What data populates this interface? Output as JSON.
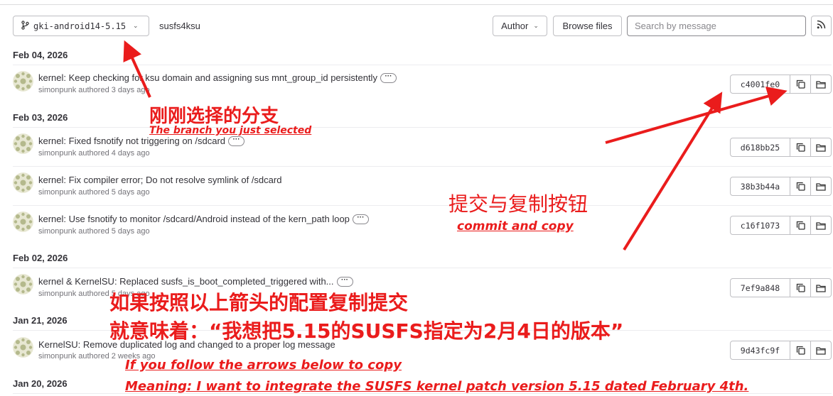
{
  "toolbar": {
    "branch": "gki-android14-5.15",
    "path": "susfs4ksu",
    "author_label": "Author",
    "browse_label": "Browse files",
    "search_placeholder": "Search by message"
  },
  "groups": [
    {
      "date": "Feb 04, 2026",
      "commits": [
        {
          "title": "kernel: Keep checking for ksu domain and assigning sus mnt_group_id persistently",
          "author": "simonpunk",
          "time": "authored 3 days ago",
          "sha": "c4001fe0",
          "has_more": true
        }
      ]
    },
    {
      "date": "Feb 03, 2026",
      "commits": [
        {
          "title": "kernel: Fixed fsnotify not triggering on /sdcard",
          "author": "simonpunk",
          "time": "authored 4 days ago",
          "sha": "d618bb25",
          "has_more": true
        },
        {
          "title": "kernel: Fix compiler error; Do not resolve symlink of /sdcard",
          "author": "simonpunk",
          "time": "authored 5 days ago",
          "sha": "38b3b44a",
          "has_more": false
        },
        {
          "title": "kernel: Use fsnotify to monitor /sdcard/Android instead of the kern_path loop",
          "author": "simonpunk",
          "time": "authored 5 days ago",
          "sha": "c16f1073",
          "has_more": true
        }
      ]
    },
    {
      "date": "Feb 02, 2026",
      "commits": [
        {
          "title": "kernel & KernelSU: Replaced susfs_is_boot_completed_triggered with...",
          "author": "simonpunk",
          "time": "authored 5 days ago",
          "sha": "7ef9a848",
          "has_more": true
        }
      ]
    },
    {
      "date": "Jan 21, 2026",
      "commits": [
        {
          "title": "KernelSU: Remove duplicated log and changed to a proper log message",
          "author": "simonpunk",
          "time": "authored 2 weeks ago",
          "sha": "9d43fc9f",
          "has_more": false
        }
      ]
    },
    {
      "date": "Jan 20, 2026",
      "commits": []
    }
  ],
  "annotations": {
    "branch_cn": "刚刚选择的分支",
    "branch_en": "The branch you just selected",
    "commit_cn": "提交与复制按钮",
    "commit_en": "commit and copy",
    "meaning_cn_1": "如果按照以上箭头的配置复制提交",
    "meaning_cn_2": "就意味着：“我想把5.15的SUSFS指定为2月4日的版本”",
    "meaning_en_1": "If you follow the arrows below to copy",
    "meaning_en_2": "Meaning: I want to integrate the SUSFS kernel patch version 5.15 dated February 4th."
  },
  "colors": {
    "annotation": "#ea1c1c",
    "avatar": "#b4b98c"
  },
  "icons": [
    "branch-icon",
    "chevron-down-icon",
    "rss-icon",
    "copy-icon",
    "folder-icon",
    "avatar-pattern-icon"
  ]
}
